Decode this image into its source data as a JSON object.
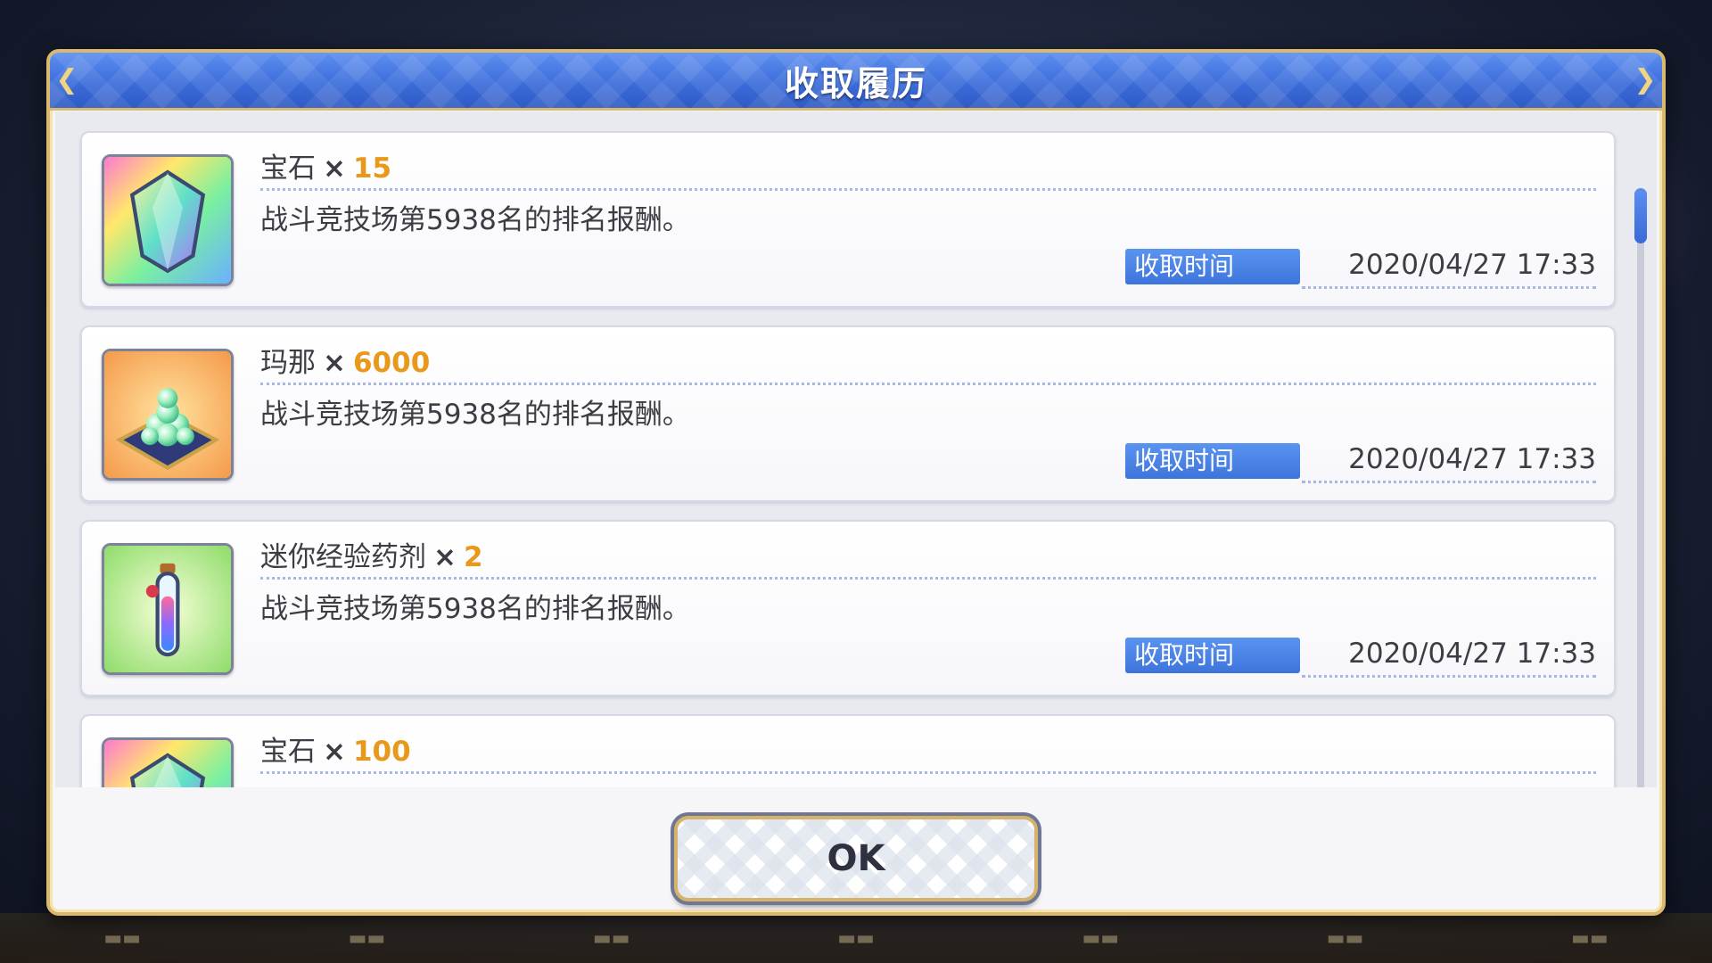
{
  "dialog": {
    "title": "收取履历",
    "ok_label": "OK"
  },
  "entries": [
    {
      "item": "宝石",
      "times": "×",
      "qty": "15",
      "icon": "rainbow-gem",
      "desc": "战斗竞技场第5938名的排名报酬。",
      "time_label": "收取时间",
      "time": "2020/04/27 17:33"
    },
    {
      "item": "玛那",
      "times": "×",
      "qty": "6000",
      "icon": "mana-orbs-on-cushion",
      "desc": "战斗竞技场第5938名的排名报酬。",
      "time_label": "收取时间",
      "time": "2020/04/27 17:33"
    },
    {
      "item": "迷你经验药剂",
      "times": "×",
      "qty": "2",
      "icon": "mini-exp-potion",
      "desc": "战斗竞技场第5938名的排名报酬。",
      "time_label": "收取时间",
      "time": "2020/04/27 17:33"
    },
    {
      "item": "宝石",
      "times": "×",
      "qty": "100",
      "icon": "rainbow-gem",
      "desc": "",
      "time_label": "",
      "time": ""
    }
  ],
  "colors": {
    "title_bar": "#3a6ad8",
    "quantity": "#e9981a",
    "time_badge": "#4a82e6",
    "frame_gold": "#d9b96e"
  }
}
